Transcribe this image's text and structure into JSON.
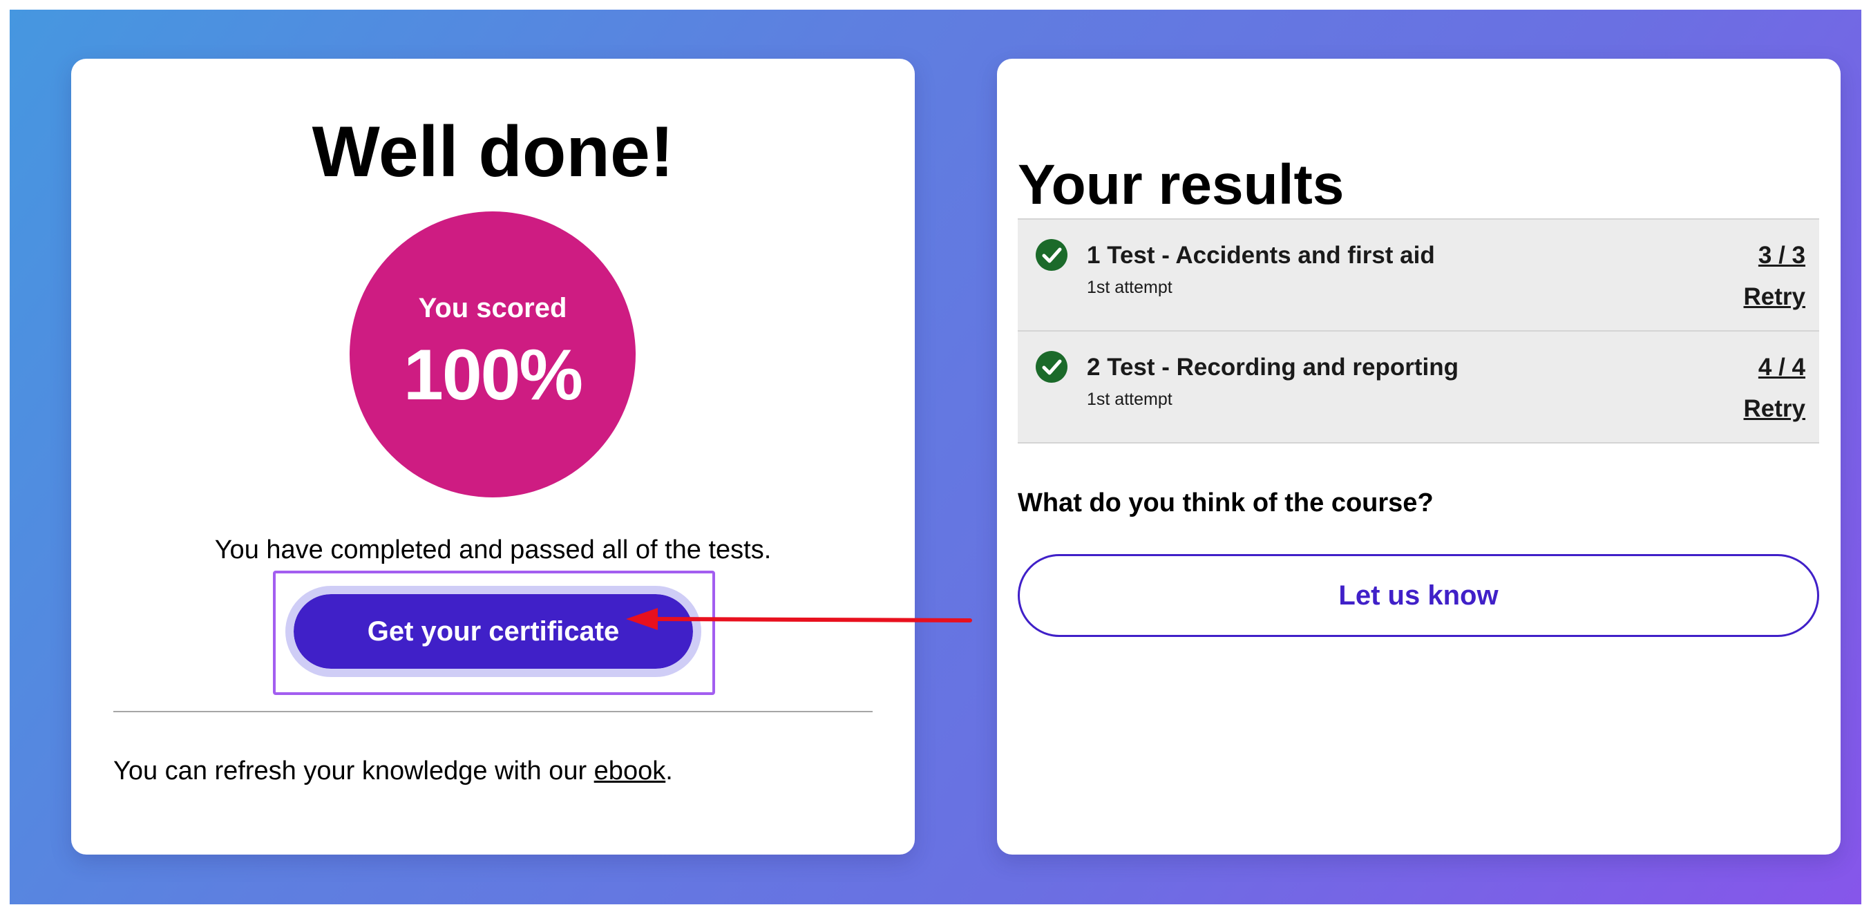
{
  "summary": {
    "title": "Well done!",
    "score_label": "You scored",
    "score_value": "100%",
    "completed_text": "You have completed and passed all of the tests.",
    "certificate_button": "Get your certificate",
    "refresh_prefix": "You can refresh your knowledge with our ",
    "refresh_link": "ebook",
    "refresh_suffix": "."
  },
  "results": {
    "title": "Your results",
    "items": [
      {
        "name": "1 Test - Accidents and first aid",
        "attempt": "1st attempt",
        "score": "3 / 3",
        "retry": "Retry"
      },
      {
        "name": "2 Test - Recording and reporting",
        "attempt": "1st attempt",
        "score": "4 / 4",
        "retry": "Retry"
      }
    ],
    "feedback_question": "What do you think of the course?",
    "feedback_button": "Let us know"
  },
  "colors": {
    "score_circle": "#ce1c82",
    "primary": "#4020c8",
    "success": "#1b6a2a",
    "annotation_arrow": "#e8101e",
    "annotation_box": "#a35ef0"
  },
  "icons": [
    "check-circle-icon",
    "annotation-arrow-icon"
  ]
}
